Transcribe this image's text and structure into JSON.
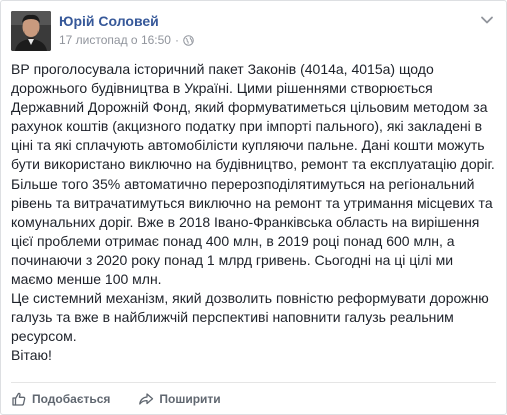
{
  "post": {
    "author": "Юрій Соловей",
    "timestamp": "17 листопад о 16:50",
    "separator": "·",
    "privacy_icon": "globe-icon",
    "menu_icon": "chevron-down-icon",
    "paragraphs": [
      "ВР проголосувала історичний пакет Законів (4014а, 4015а) щодо дорожнього будівництва в Україні. Цими рішеннями створюється Державний Дорожній Фонд, який формуватиметься цільовим методом за рахунок коштів (акцизного податку при імпорті пального), які закладені в ціні та які сплачують автомобілісти купляючи пальне. Дані кошти можуть бути використано виключно на будівництво, ремонт та експлуатацію доріг. Більше того 35% автоматично перерозподілятимуться на регіональний рівень та витрачатимуться виключно на ремонт та утримання місцевих та комунальних доріг. Вже в 2018 Івано-Франківська область на вирішення цієї проблеми отримає понад 400 млн, в 2019 році понад 600 млн, а починаючи з 2020 року понад 1 млрд гривень. Сьогодні на ці цілі ми маємо менше 100 млн.",
      "Це системний механізм, який дозволить повністю реформувати дорожню галузь та вже в найближчій перспективі наповнити галузь реальним ресурсом.",
      "Вітаю!"
    ]
  },
  "actions": {
    "like_label": "Подобається",
    "like_icon": "thumbs-up-icon",
    "share_label": "Поширити",
    "share_icon": "share-arrow-icon"
  },
  "colors": {
    "author": "#365899",
    "meta": "#90949c",
    "text": "#1d2129",
    "action": "#606770"
  }
}
